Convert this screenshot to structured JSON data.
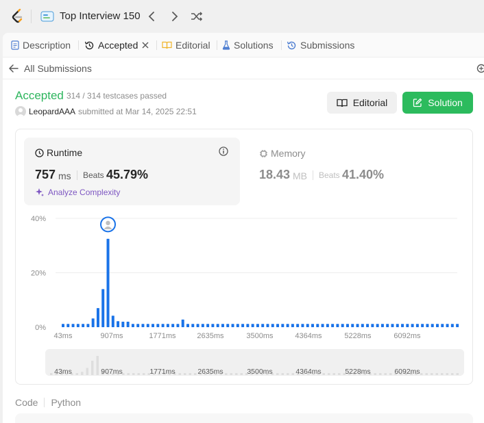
{
  "topbar": {
    "list_title": "Top Interview 150",
    "icons": [
      "leetcode-logo",
      "study-plan-icon",
      "chevron-left-icon",
      "chevron-right-icon",
      "shuffle-icon"
    ]
  },
  "tabs": [
    {
      "label": "Description",
      "icon": "description-icon",
      "active": false
    },
    {
      "label": "Accepted",
      "icon": "history-icon",
      "active": true,
      "closable": true
    },
    {
      "label": "Editorial",
      "icon": "book-icon",
      "active": false
    },
    {
      "label": "Solutions",
      "icon": "flask-icon",
      "active": false
    },
    {
      "label": "Submissions",
      "icon": "history-icon",
      "active": false
    }
  ],
  "back": {
    "label": "All Submissions"
  },
  "submission": {
    "status": "Accepted",
    "testcases": "314 / 314 testcases passed",
    "author": "LeopardAAA",
    "submitted_at": "submitted at Mar 14, 2025 22:51"
  },
  "actions": {
    "editorial_label": "Editorial",
    "solution_label": "Solution"
  },
  "runtime": {
    "title": "Runtime",
    "value": "757",
    "unit": "ms",
    "beats_label": "Beats",
    "beats": "45.79%",
    "analyze_label": "Analyze Complexity"
  },
  "memory": {
    "title": "Memory",
    "value": "18.43",
    "unit": "MB",
    "beats_label": "Beats",
    "beats": "41.40%"
  },
  "chart_data": {
    "type": "bar",
    "title": "",
    "xlabel": "",
    "ylabel": "",
    "ylim": [
      0,
      40
    ],
    "y_ticks": [
      "0%",
      "20%",
      "40%"
    ],
    "x_ticks": [
      "43ms",
      "907ms",
      "1771ms",
      "2635ms",
      "3500ms",
      "4364ms",
      "5228ms",
      "6092ms"
    ],
    "values": [
      1.2,
      1.2,
      1.2,
      1.2,
      1.2,
      1.2,
      3.2,
      7,
      14,
      32.5,
      4.2,
      2.2,
      2,
      2,
      1.2,
      1.2,
      1.2,
      1.2,
      1.2,
      1.2,
      1.2,
      1.2,
      1.2,
      1.2,
      2.8,
      1.2,
      1.2,
      1.2,
      1.2,
      1.2,
      1.2,
      1.2,
      1.2,
      1.2,
      1.2,
      1.2,
      1.2,
      1.2,
      1.2,
      1.2,
      1.2,
      1.2,
      1.2,
      1.2,
      1.2,
      1.2,
      1.2,
      1.2,
      1.2,
      1.2,
      1.2,
      1.2,
      1.2,
      1.2,
      1.2,
      1.2,
      1.2,
      1.2,
      1.2,
      1.2,
      1.2,
      1.2,
      1.2,
      1.2,
      1.2,
      1.2,
      1.2,
      1.2,
      1.2,
      1.2,
      1.2,
      1.2,
      1.2,
      1.2,
      1.2,
      1.2,
      1.2,
      1.2,
      1.2,
      1.2
    ],
    "highlight_index": 9,
    "grid": true,
    "bar_color": "#1a73e8"
  },
  "code": {
    "tab_label": "Code",
    "language": "Python"
  },
  "colors": {
    "accepted": "#2db55d",
    "solution_button": "#2cbb5d",
    "bar": "#1a73e8",
    "analyze": "#7e57c2"
  }
}
